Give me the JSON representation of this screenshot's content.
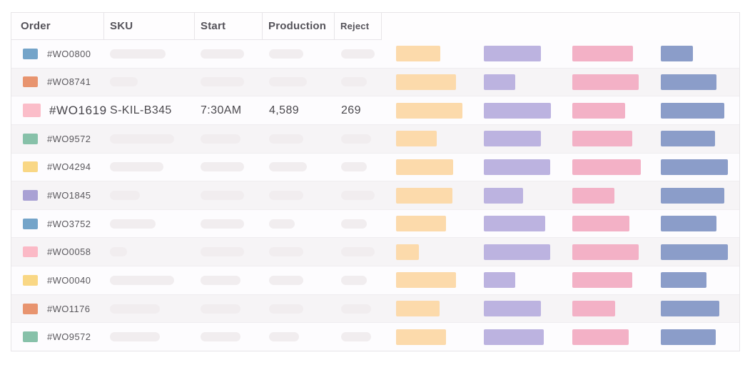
{
  "table": {
    "columns": {
      "order": "Order",
      "sku": "SKU",
      "start": "Start",
      "production": "Production",
      "reject": "Reject"
    },
    "rows": [
      {
        "order": "#WO0800",
        "swatch_color": "#74a4c9",
        "loading": true,
        "placeholders": {
          "sku": 78,
          "start": 61,
          "production": 48,
          "reject": 47
        },
        "bars": {
          "orange": 62,
          "purple": 80,
          "pink": 85,
          "blue": 45
        }
      },
      {
        "order": "#WO8741",
        "swatch_color": "#e8946f",
        "loading": true,
        "placeholders": {
          "sku": 39,
          "start": 61,
          "production": 53,
          "reject": 36
        },
        "bars": {
          "orange": 84,
          "purple": 44,
          "pink": 93,
          "blue": 78
        }
      },
      {
        "order": "#WO1619",
        "swatch_color": "#fbbdc9",
        "loading": false,
        "sku": "S-KIL-B345",
        "start": "7:30AM",
        "production": "4,589",
        "reject": "269",
        "bars": {
          "orange": 93,
          "purple": 94,
          "pink": 74,
          "blue": 89
        }
      },
      {
        "order": "#WO9572",
        "swatch_color": "#87c1a9",
        "loading": true,
        "placeholders": {
          "sku": 90,
          "start": 56,
          "production": 48,
          "reject": 42
        },
        "bars": {
          "orange": 57,
          "purple": 80,
          "pink": 84,
          "blue": 76
        }
      },
      {
        "order": "#WO4294",
        "swatch_color": "#f9d785",
        "loading": true,
        "placeholders": {
          "sku": 75,
          "start": 61,
          "production": 53,
          "reject": 36
        },
        "bars": {
          "orange": 80,
          "purple": 93,
          "pink": 96,
          "blue": 94
        }
      },
      {
        "order": "#WO1845",
        "swatch_color": "#a9a1d4",
        "loading": true,
        "placeholders": {
          "sku": 42,
          "start": 61,
          "production": 48,
          "reject": 47
        },
        "bars": {
          "orange": 79,
          "purple": 55,
          "pink": 59,
          "blue": 89
        }
      },
      {
        "order": "#WO3752",
        "swatch_color": "#74a4c9",
        "loading": true,
        "placeholders": {
          "sku": 64,
          "start": 61,
          "production": 36,
          "reject": 36
        },
        "bars": {
          "orange": 70,
          "purple": 86,
          "pink": 80,
          "blue": 78
        }
      },
      {
        "order": "#WO0058",
        "swatch_color": "#fbb9c6",
        "loading": true,
        "placeholders": {
          "sku": 24,
          "start": 61,
          "production": 48,
          "reject": 47
        },
        "bars": {
          "orange": 32,
          "purple": 93,
          "pink": 93,
          "blue": 94
        }
      },
      {
        "order": "#WO0040",
        "swatch_color": "#f9d785",
        "loading": true,
        "placeholders": {
          "sku": 90,
          "start": 56,
          "production": 48,
          "reject": 36
        },
        "bars": {
          "orange": 84,
          "purple": 44,
          "pink": 84,
          "blue": 64
        }
      },
      {
        "order": "#WO1176",
        "swatch_color": "#e8946f",
        "loading": true,
        "placeholders": {
          "sku": 70,
          "start": 56,
          "production": 48,
          "reject": 42
        },
        "bars": {
          "orange": 61,
          "purple": 80,
          "pink": 60,
          "blue": 82
        }
      },
      {
        "order": "#WO9572",
        "swatch_color": "#87c1a9",
        "loading": true,
        "placeholders": {
          "sku": 70,
          "start": 56,
          "production": 42,
          "reject": 42
        },
        "bars": {
          "orange": 70,
          "purple": 84,
          "pink": 79,
          "blue": 77
        }
      }
    ]
  },
  "bar_colors": {
    "orange": "#fcdaab",
    "purple": "#bcb3e0",
    "pink": "#f3b1c6",
    "blue": "#8b9dc9"
  },
  "placeholder_color": "#f1edef",
  "border_color": "#e7e5e8"
}
